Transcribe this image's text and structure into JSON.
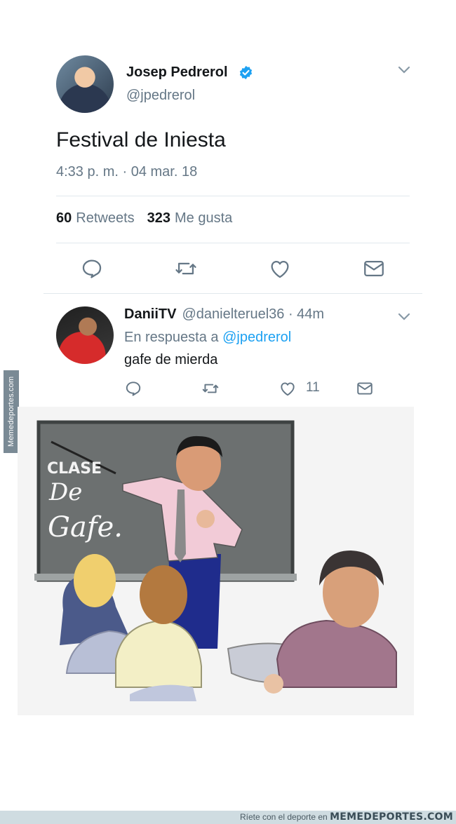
{
  "tweet": {
    "author_name": "Josep Pedrerol",
    "author_handle": "@jpedrerol",
    "text": "Festival de Iniesta",
    "timestamp": "4:33 p. m. · 04 mar. 18",
    "retweets_count": "60",
    "retweets_label": "Retweets",
    "likes_count": "323",
    "likes_label": "Me gusta",
    "verified": true
  },
  "reply": {
    "author_name": "DaniiTV",
    "meta": "@danielteruel36 · 44m",
    "in_reply_prefix": "En respuesta a",
    "in_reply_mention": "@jpedrerol",
    "text": "gafe de mierda",
    "like_count": "11"
  },
  "meme": {
    "board_text_line1": "CLASE",
    "board_text_line2": "De",
    "board_text_line3": "Gafe."
  },
  "watermark": {
    "side": "Memedeportes.com",
    "footer_prefix": "Ríete con el deporte en",
    "footer_brand": "MEMEDEPORTES.COM"
  },
  "colors": {
    "link": "#1da1f2",
    "secondary_text": "#657786",
    "primary_text": "#14171a"
  },
  "icons": [
    "verified-badge-icon",
    "chevron-down-icon",
    "reply-icon",
    "retweet-icon",
    "like-icon",
    "direct-message-icon"
  ]
}
